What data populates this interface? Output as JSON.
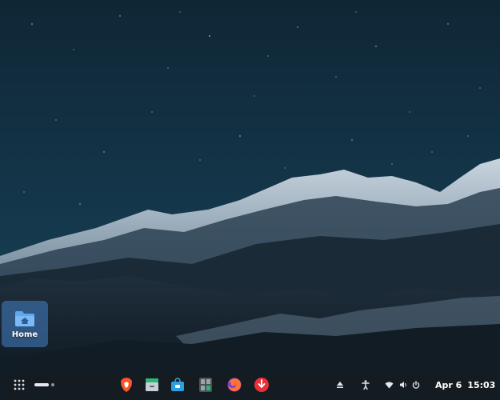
{
  "desktop": {
    "icons": [
      {
        "label": "Home",
        "icon": "folder-home-icon"
      }
    ]
  },
  "dock": {
    "apps": [
      {
        "name": "brave-browser",
        "icon": "brave-lion-icon",
        "color": "#fb542b"
      },
      {
        "name": "file-manager",
        "icon": "file-cabinet-icon",
        "color": "#2bb673"
      },
      {
        "name": "app-store",
        "icon": "shopping-bag-icon",
        "color": "#2c9fe0"
      },
      {
        "name": "calculator",
        "icon": "calculator-icon",
        "color": "#9aa5a8"
      },
      {
        "name": "firefox",
        "icon": "firefox-icon",
        "color": "#ff7139"
      },
      {
        "name": "downloader",
        "icon": "download-arrow-icon",
        "color": "#e8303a"
      }
    ],
    "tray": {
      "date": "Apr 6",
      "time": "15:03"
    }
  },
  "colors": {
    "dock_background": "#161c22",
    "desktop_icon_highlight": "#4682c8",
    "folder_blue": "#5fa8f0"
  }
}
